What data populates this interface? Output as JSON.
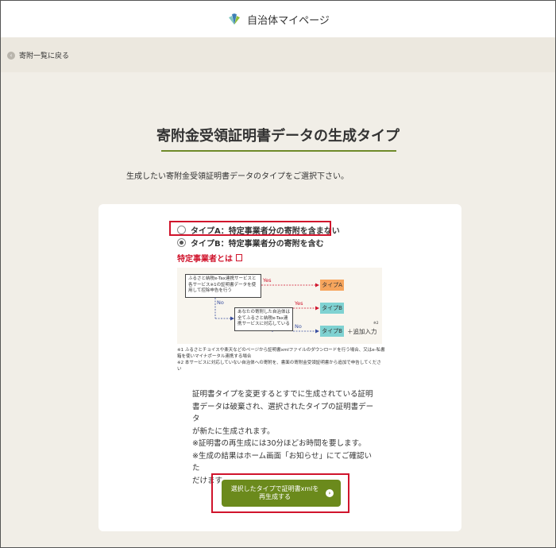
{
  "header": {
    "title": "自治体マイページ"
  },
  "breadcrumb": {
    "back_label": "寄附一覧に戻る"
  },
  "page": {
    "title": "寄附金受領証明書データの生成タイプ",
    "intro": "生成したい寄附金受領証明書データのタイプをご選択下さい。"
  },
  "options": [
    {
      "label": "タイプA：特定事業者分の寄附を含まない",
      "selected": false
    },
    {
      "label": "タイプB：特定事業者分の寄附を含む",
      "selected": true
    }
  ],
  "tokutei_link": "特定事業者とは",
  "flow": {
    "box1": "ふるさと納税e-Tax連携サービスと各サービス※1の証明書データを使用して控除申告を行う",
    "box2": "あなたの寄附した自治体は全てふるさと納税e-Tax連携サービスに対応している",
    "yes": "Yes",
    "no": "No",
    "type_a": "タイプA",
    "type_b": "タイプB",
    "extra": "＋追加入力",
    "extra_note": "※2"
  },
  "notes": [
    "※1 ふるさとチョイスや楽天などのページから証明書xmlファイルのダウンロードを行う場合、又はe-私書箱を使いマイナポータル連携する場合",
    "※2 本サービスに対応していない自治体への寄附を、書面の寄附金受領証明書から追加で申告してください"
  ],
  "warning_lines": [
    "証明書タイプを変更するとすでに生成されている証明",
    "書データは破棄され、選択されたタイプの証明書データ",
    "が新たに生成されます。",
    "※証明書の再生成には30分ほどお時間を要します。",
    "※生成の結果はホーム画面「お知らせ」にてご確認いた",
    "だけます。"
  ],
  "submit": {
    "line1": "選択したタイプで証明書xmlを",
    "line2": "再生成する"
  },
  "colors": {
    "accent_green": "#6b8a1c",
    "highlight_red": "#d0142c",
    "type_a_orange": "#f6a55d",
    "type_b_teal": "#7fd2d2"
  }
}
